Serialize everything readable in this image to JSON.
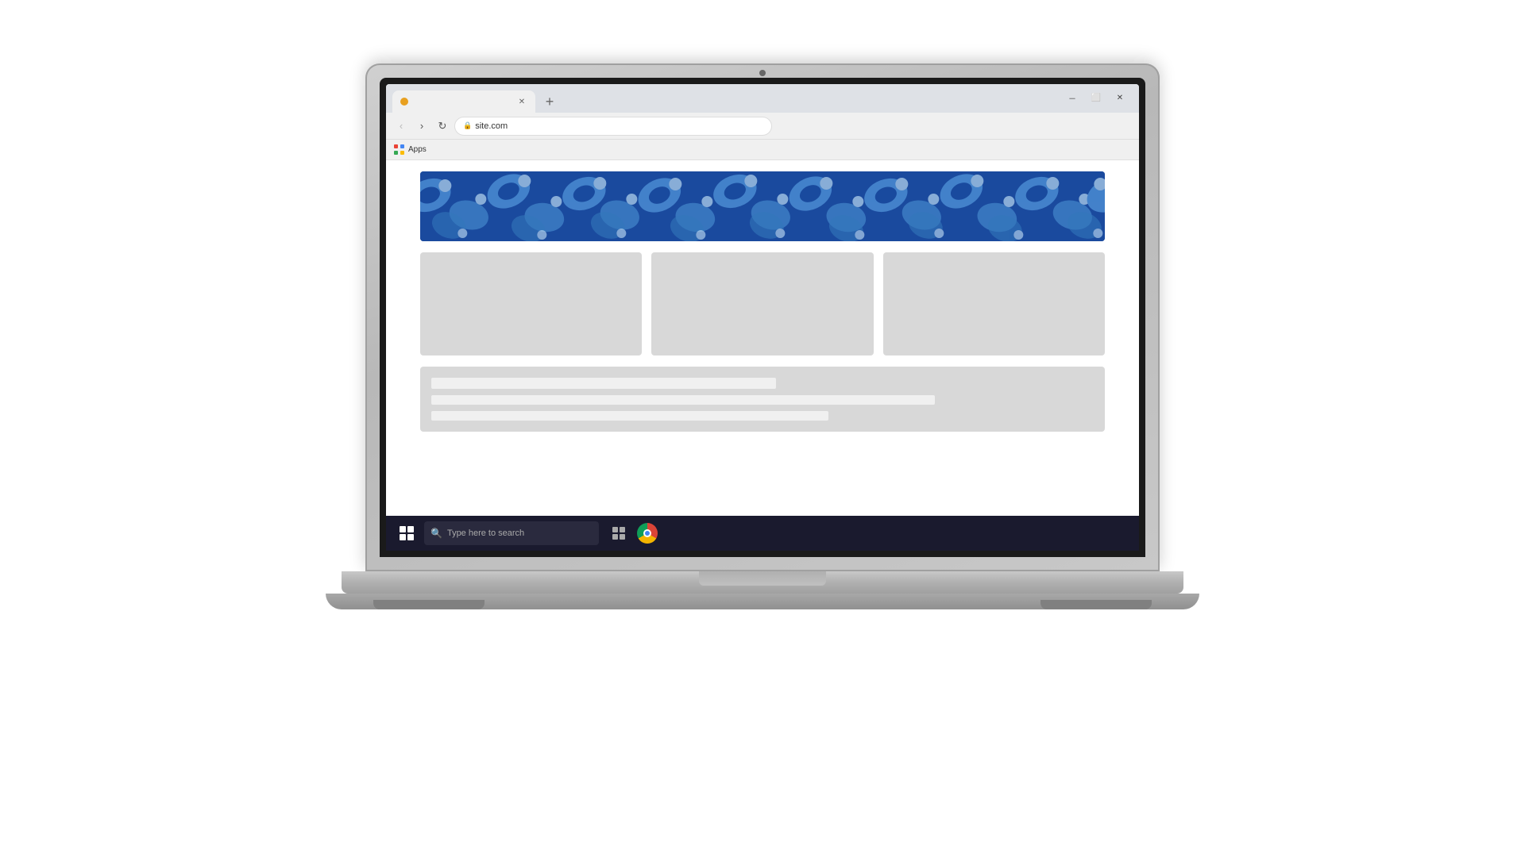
{
  "browser": {
    "tab_label": "",
    "address": "site.com",
    "lock_icon": "🔒",
    "bookmark_label": "Apps",
    "window_controls": [
      "minimize",
      "maximize",
      "close"
    ]
  },
  "taskbar": {
    "search_placeholder": "Type here to search"
  },
  "page": {
    "hero_alt": "Decorative floral wave banner",
    "cards": [
      "card-1",
      "card-2",
      "card-3"
    ],
    "text_bars": [
      "short",
      "long",
      "medium"
    ]
  }
}
